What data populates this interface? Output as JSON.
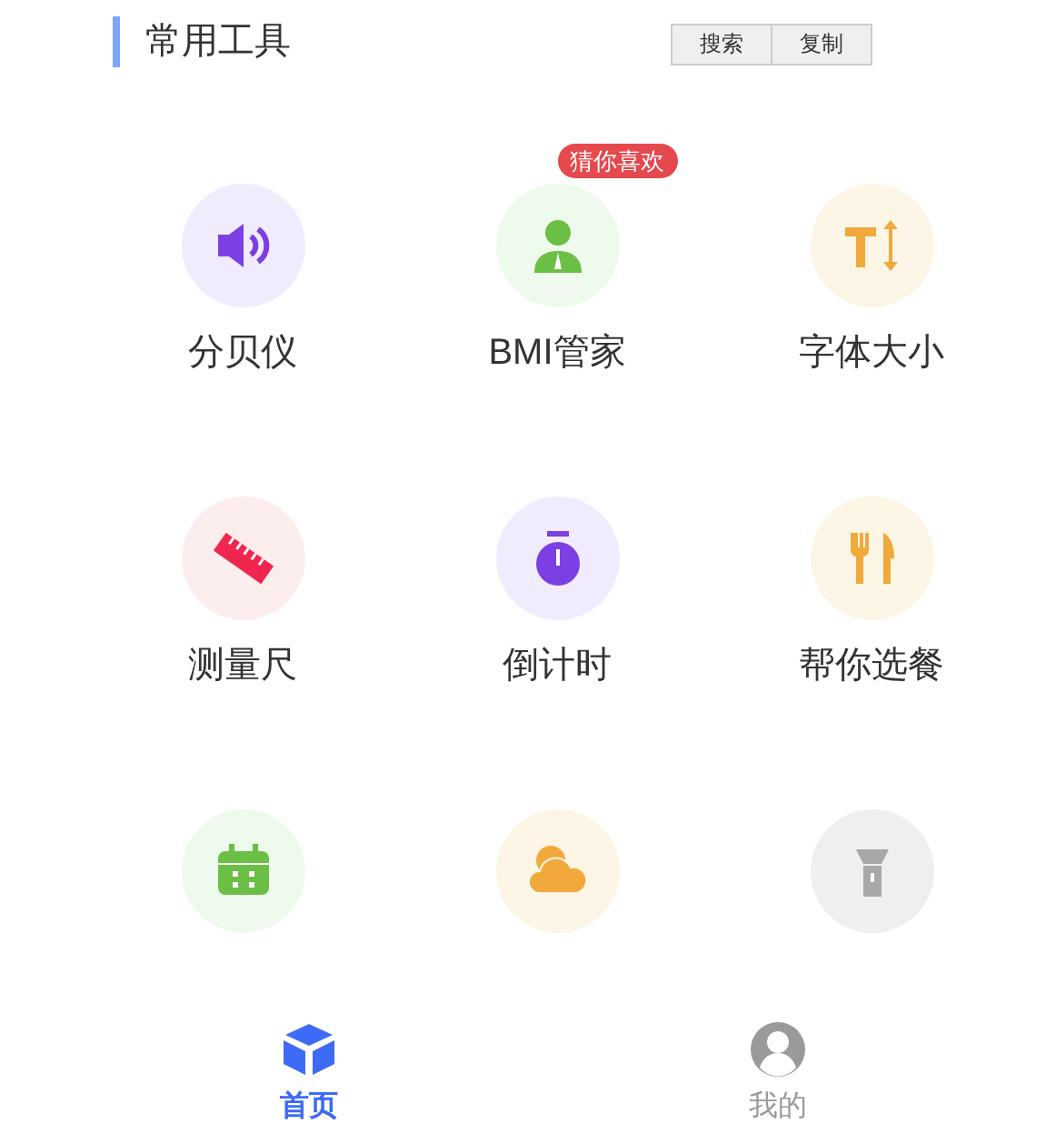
{
  "header": {
    "title": "常用工具",
    "buttons": [
      "搜索",
      "复制"
    ]
  },
  "tools": [
    {
      "kind": "speaker",
      "color": "#7b3fe4",
      "label": "分贝仪"
    },
    {
      "kind": "person",
      "color": "#6cbf45",
      "label": "BMI管家",
      "badge": "猜你喜欢"
    },
    {
      "kind": "font-size",
      "color": "#f2a93b",
      "label": "字体大小"
    },
    {
      "kind": "ruler",
      "color": "#f0264f",
      "label": "测量尺"
    },
    {
      "kind": "stopwatch",
      "color": "#7b3fe4",
      "label": "倒计时"
    },
    {
      "kind": "cutlery",
      "color": "#f2a93b",
      "label": "帮你选餐"
    },
    {
      "kind": "calendar",
      "color": "#6cbf45"
    },
    {
      "kind": "cloud",
      "color": "#f2a93b"
    },
    {
      "kind": "flashlight",
      "color": "#a8a8a8"
    }
  ],
  "tab_bar": [
    {
      "kind": "cube",
      "label": "首页",
      "selected": true
    },
    {
      "kind": "user",
      "label": "我的",
      "selected": false
    }
  ]
}
